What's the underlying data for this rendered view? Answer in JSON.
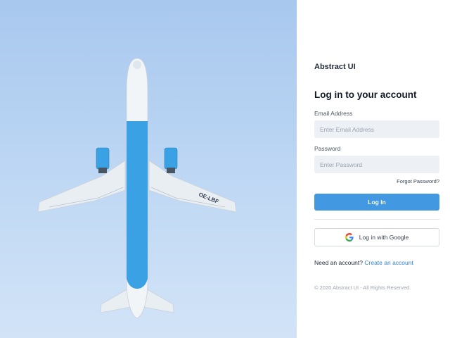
{
  "hero": {
    "image": "airplane-from-below",
    "registration": "OE-LBF",
    "colors": {
      "sky": "#b6d2f2",
      "fuselage_accent": "#3aa2e4",
      "body": "#f2f5f8"
    }
  },
  "brand": {
    "name": "Abstract UI"
  },
  "form": {
    "heading": "Log in to your account",
    "email": {
      "label": "Email Address",
      "placeholder": "Enter Email Address",
      "value": ""
    },
    "password": {
      "label": "Password",
      "placeholder": "Enter Password",
      "value": ""
    },
    "forgot_label": "Forgot Password?",
    "login_label": "Log In",
    "google_label": "Log in with Google",
    "google_icon": "google-g-icon",
    "signup_prompt": "Need an account?",
    "signup_link": "Create an account"
  },
  "footer": {
    "copyright": "© 2020 Abstract UI - All Rights Reserved."
  },
  "colors": {
    "primary": "#4299e1",
    "link": "#3182ce",
    "input_bg": "#edf1f6"
  }
}
